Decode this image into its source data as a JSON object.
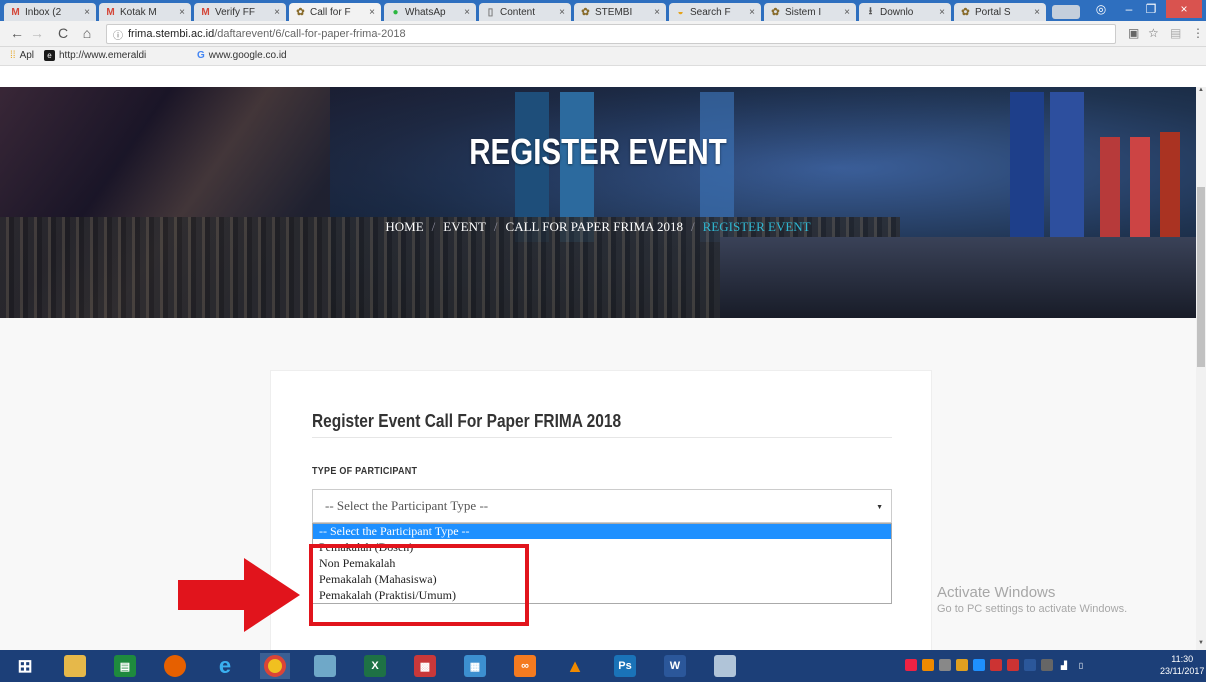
{
  "browser": {
    "tabs": [
      {
        "title": "Inbox (2",
        "icon": "gmail-icon",
        "glyph": "M",
        "color": "#d44638"
      },
      {
        "title": "Kotak M",
        "icon": "gmail-icon",
        "glyph": "M",
        "color": "#d44638"
      },
      {
        "title": "Verify FF",
        "icon": "gmail-icon",
        "glyph": "M",
        "color": "#d44638"
      },
      {
        "title": "Call for F",
        "icon": "stembi-icon",
        "glyph": "✿",
        "color": "#8a6d2e"
      },
      {
        "title": "WhatsAp",
        "icon": "whatsapp-icon",
        "glyph": "●",
        "color": "#2bb741"
      },
      {
        "title": "Content",
        "icon": "document-icon",
        "glyph": "▯",
        "color": "#777"
      },
      {
        "title": "STEMBI",
        "icon": "stembi-icon",
        "glyph": "✿",
        "color": "#8a6d2e"
      },
      {
        "title": "Search F",
        "icon": "search-site-icon",
        "glyph": "◒",
        "color": "#e5a31b"
      },
      {
        "title": "Sistem I",
        "icon": "stembi-icon",
        "glyph": "✿",
        "color": "#8a6d2e"
      },
      {
        "title": "Downlo",
        "icon": "download-icon",
        "glyph": "⭳",
        "color": "#555"
      },
      {
        "title": "Portal S",
        "icon": "stembi-icon",
        "glyph": "✿",
        "color": "#8a6d2e"
      }
    ],
    "tab_close": "×",
    "url_host": "frima.stembi.ac.id",
    "url_path": "/daftarevent/6/call-for-paper-frima-2018",
    "bookmarks": [
      {
        "label": "Apl",
        "icon": "apps-grid-icon"
      },
      {
        "label": "http://www.emeraldi",
        "icon": "emerald-icon"
      },
      {
        "label": "www.google.co.id",
        "icon": "google-icon"
      }
    ]
  },
  "hero": {
    "title": "REGISTER EVENT",
    "breadcrumb": [
      "HOME",
      "EVENT",
      "CALL FOR PAPER FRIMA 2018",
      "REGISTER EVENT"
    ],
    "separator": "/"
  },
  "form": {
    "heading": "Register Event Call For Paper FRIMA 2018",
    "participant_label": "TYPE OF PARTICIPANT",
    "selected_value": "-- Select the Participant Type --",
    "options": [
      "-- Select the Participant Type --",
      "Pemakalah (Dosen)",
      "Non Pemakalah",
      "Pemakalah (Mahasiswa)",
      "Pemakalah (Praktisi/Umum)"
    ]
  },
  "watermark": {
    "line1": "Activate Windows",
    "line2": "Go to PC settings to activate Windows."
  },
  "taskbar": {
    "time": "11:30",
    "date": "23/11/2017"
  },
  "colors": {
    "accent": "#2fb6d0",
    "annotation_red": "#e1141c",
    "dropdown_highlight": "#1e90ff"
  }
}
